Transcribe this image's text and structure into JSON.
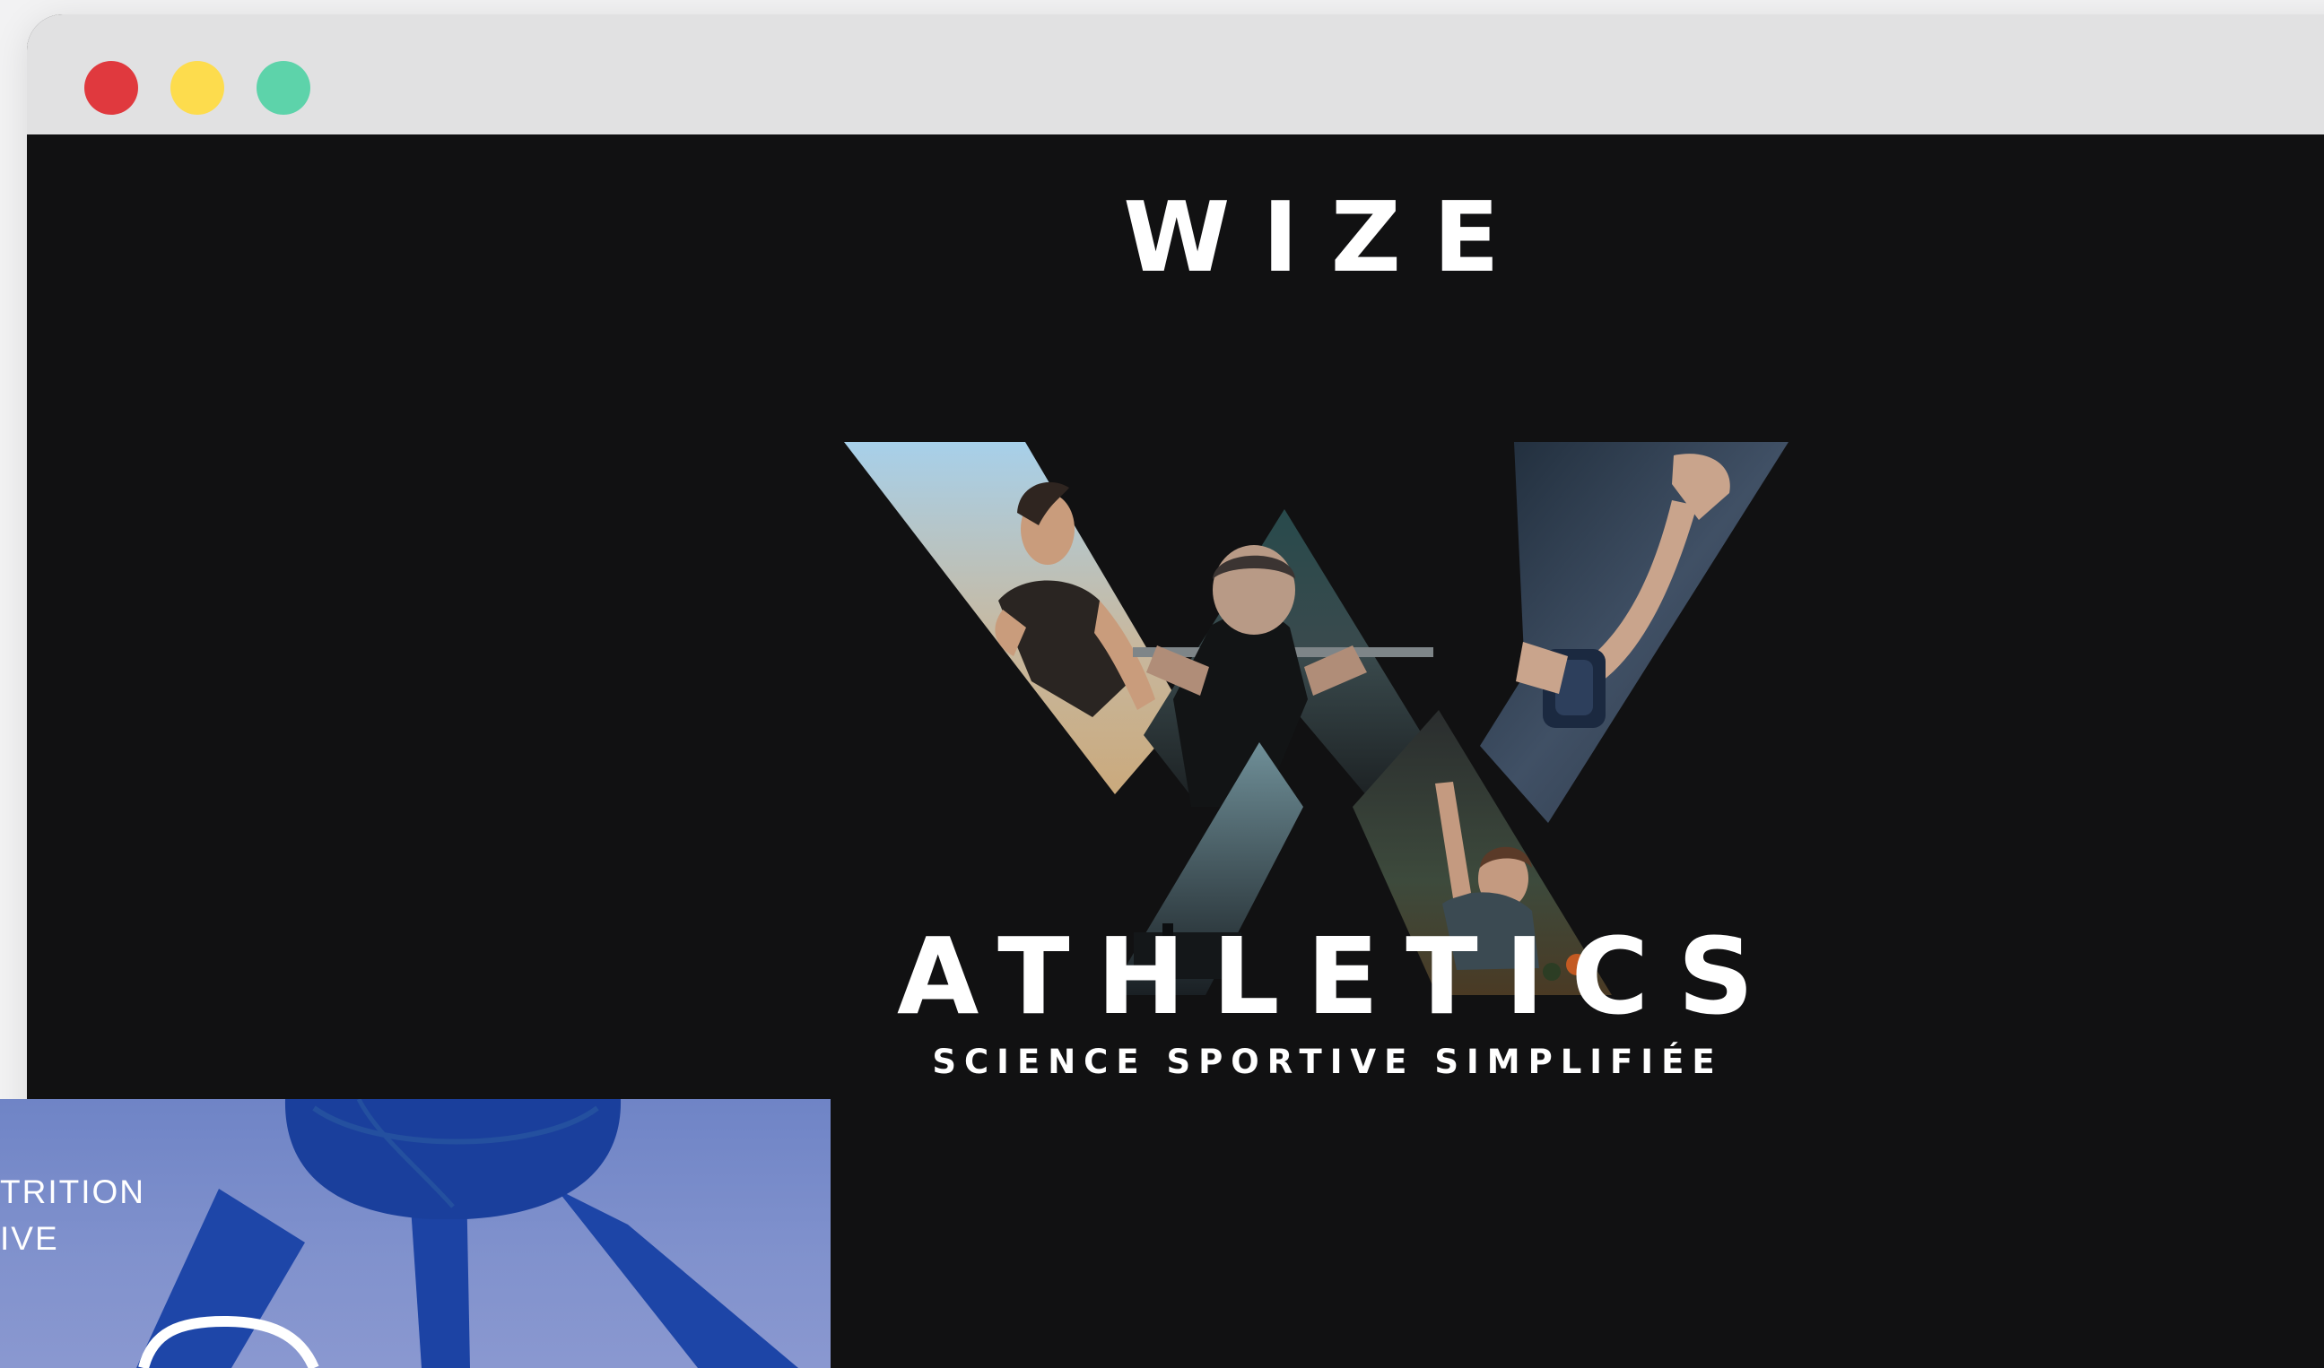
{
  "window": {
    "controls": {
      "close": {
        "icon": "close-dot-icon",
        "color": "#e0393e"
      },
      "minimize": {
        "icon": "minimize-dot-icon",
        "color": "#fddc4d"
      },
      "maximize": {
        "icon": "maximize-dot-icon",
        "color": "#5dd3aa"
      }
    }
  },
  "hero": {
    "brand_top": "WIZE",
    "brand_bottom": "ATHLETICS",
    "tagline": "SCIENCE SPORTIVE SIMPLIFIÉE",
    "logo_icon": "x-photo-collage-logo",
    "background": "#111112"
  },
  "preview_card": {
    "line1": "TRITION",
    "line2": "IVE",
    "icon": "atom-sculpture-image"
  }
}
